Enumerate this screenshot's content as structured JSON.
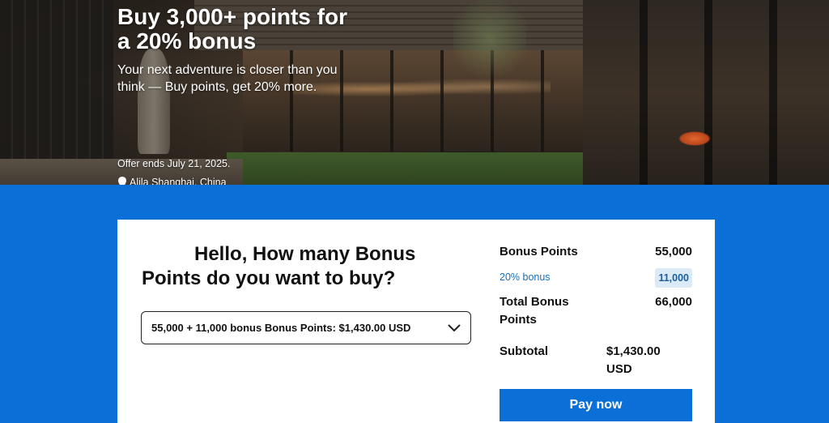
{
  "hero": {
    "title": "Buy 3,000+ points for a 20% bonus",
    "subtitle": "Your next adventure is closer than you think — Buy points, get 20% more.",
    "offer_ends": "Offer ends July 21, 2025.",
    "location": "Alila Shanghai, China",
    "location_icon": "map-pin-icon"
  },
  "purchase": {
    "question_hello": "Hello",
    "question_rest": ", How many Bonus Points do you want to buy?",
    "selected_option": "55,000 + 11,000 bonus Bonus Points: $1,430.00 USD",
    "dropdown_icon": "chevron-down-icon"
  },
  "summary": {
    "bonus_points_label": "Bonus Points",
    "bonus_points_value": "55,000",
    "bonus_label": "20% bonus",
    "bonus_value": "11,000",
    "total_label": "Total Bonus Points",
    "total_value": "66,000",
    "subtotal_label": "Subtotal",
    "subtotal_value": "$1,430.00 USD",
    "pay_button": "Pay now"
  },
  "colors": {
    "brand_blue": "#0a6fd6",
    "bonus_badge_bg": "#dbeaf7",
    "bonus_text": "#1a6fb6"
  }
}
